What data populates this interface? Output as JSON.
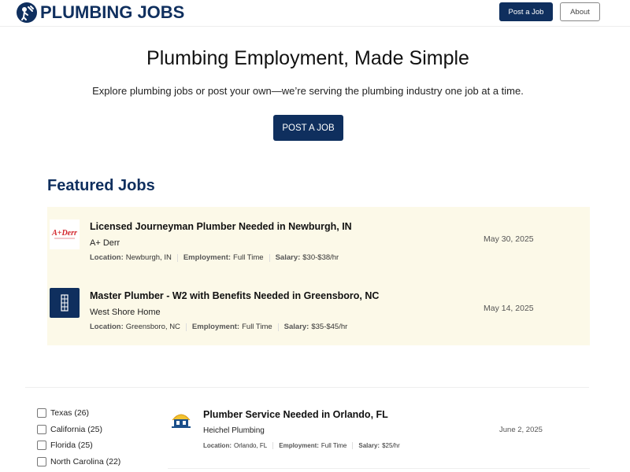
{
  "header": {
    "logo_text": "PLUMBING JOBS",
    "post_job_label": "Post a Job",
    "about_label": "About"
  },
  "hero": {
    "title": "Plumbing Employment, Made Simple",
    "subtitle": "Explore plumbing jobs or post your own—we’re serving the plumbing industry one job at a time.",
    "cta_label": "POST A JOB"
  },
  "featured": {
    "heading": "Featured Jobs",
    "jobs": [
      {
        "title": "Licensed Journeyman Plumber Needed in Newburgh, IN",
        "company": "A+ Derr",
        "location_label": "Location:",
        "location": "Newburgh, IN",
        "employment_label": "Employment:",
        "employment": "Full Time",
        "salary_label": "Salary:",
        "salary": "$30-$38/hr",
        "date": "May 30, 2025",
        "logo_text": "A+Derr"
      },
      {
        "title": "Master Plumber - W2 with Benefits Needed in Greensboro, NC",
        "company": "West Shore Home",
        "location_label": "Location:",
        "location": "Greensboro, NC",
        "employment_label": "Employment:",
        "employment": "Full Time",
        "salary_label": "Salary:",
        "salary": "$35-$45/hr",
        "date": "May 14, 2025"
      }
    ]
  },
  "filters": [
    {
      "label": "Texas (26)",
      "checked": false
    },
    {
      "label": "California (25)",
      "checked": false
    },
    {
      "label": "Florida (25)",
      "checked": false
    },
    {
      "label": "North Carolina (22)",
      "checked": false
    }
  ],
  "jobs": [
    {
      "title": "Plumber Service Needed in Orlando, FL",
      "company": "Heichel Plumbing",
      "location_label": "Location:",
      "location": "Orlando, FL",
      "employment_label": "Employment:",
      "employment": "Full Time",
      "salary_label": "Salary:",
      "salary": "$25/hr",
      "date": "June 2, 2025"
    }
  ],
  "colors": {
    "brand_navy": "#0f2f5e",
    "featured_bg": "#fcf9e8",
    "derr_red": "#d2232a"
  }
}
